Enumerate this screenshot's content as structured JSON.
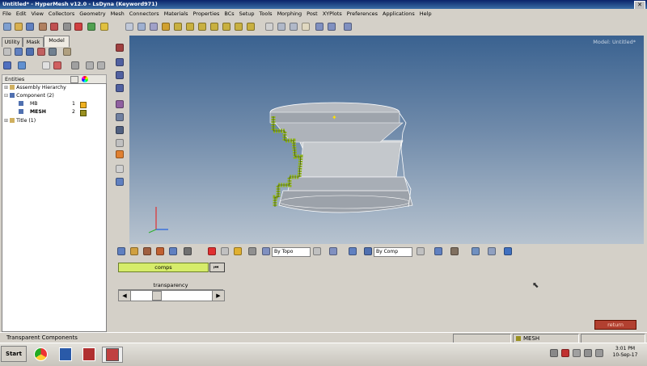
{
  "window": {
    "title": "Untitled* - HyperMesh v12.0 - LsDyna (Keyword971)"
  },
  "menu": [
    "File",
    "Edit",
    "View",
    "Collectors",
    "Geometry",
    "Mesh",
    "Connectors",
    "Materials",
    "Properties",
    "BCs",
    "Setup",
    "Tools",
    "Morphing",
    "Post",
    "XYPlots",
    "Preferences",
    "Applications",
    "Help"
  ],
  "left_tabs": [
    "Utility",
    "Mask",
    "Model"
  ],
  "entities": {
    "header": "Entities"
  },
  "tree": {
    "assembly": "Assembly Hierarchy",
    "component": "Component (2)",
    "items": [
      {
        "name": "MB",
        "id": "1",
        "color": "#f0b020"
      },
      {
        "name": "MESH",
        "id": "2",
        "color": "#9a9020"
      }
    ],
    "title": "Title (1)"
  },
  "viewport": {
    "watermark": "Model: Untitled*"
  },
  "bottom_toolbar": {
    "select_topo": "By Topo",
    "select_comp": "By Comp"
  },
  "panel": {
    "comps_label": "comps",
    "transparency_label": "transparency",
    "transparency_level": 0.3
  },
  "return_label": "return",
  "status": {
    "text": "Transparent Components",
    "component": "MESH",
    "component_color": "#9a9020"
  },
  "taskbar": {
    "start": "Start",
    "time": "3:01 PM",
    "date": "10-Sep-17"
  },
  "icons": {
    "toolbar_row1": [
      "new-icon",
      "open-icon",
      "save-icon",
      "import-icon",
      "export-icon",
      "print-icon",
      "delete-icon",
      "preferences-icon",
      "help-icon"
    ],
    "toolbar_row1b": [
      "zoom-icon",
      "pan-icon",
      "rotate-icon",
      "fit-icon",
      "iso-view-icon",
      "top-view-icon",
      "bottom-view-icon",
      "left-view-icon",
      "right-view-icon",
      "front-view-icon",
      "back-view-icon",
      "fit-sel-icon"
    ],
    "vertical": [
      "shade-icon",
      "wire-icon",
      "mesh-lines-icon",
      "element-icon",
      "feature-icon",
      "transparency-icon",
      "sphere-icon",
      "node-icon",
      "label-icon",
      "text-icon",
      "frame-icon"
    ]
  }
}
